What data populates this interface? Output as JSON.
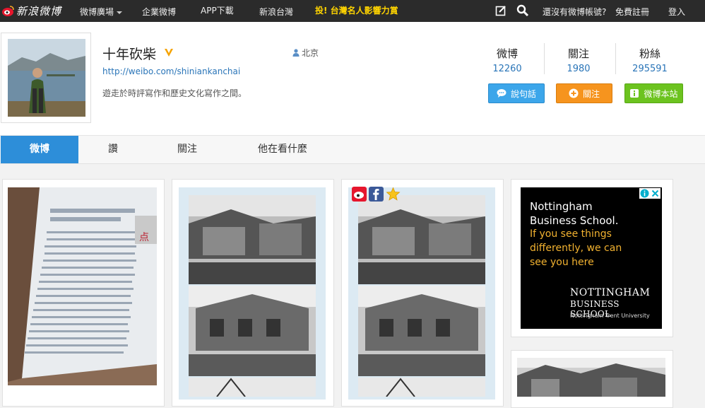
{
  "topbar": {
    "logo_text": "新浪微博",
    "nav": [
      "微博廣場",
      "企業微博",
      "APP下載",
      "新浪台灣"
    ],
    "promo": "投! 台灣名人影響力賞",
    "no_account": "還沒有微博帳號?",
    "register": "免費註冊",
    "login": "登入"
  },
  "profile": {
    "name": "十年砍柴",
    "location": "北京",
    "url": "http://weibo.com/shiniankanchai",
    "bio": "遊走於時評寫作和歷史文化寫作之間。",
    "stats": [
      {
        "label": "微博",
        "value": "12260"
      },
      {
        "label": "關注",
        "value": "1980"
      },
      {
        "label": "粉絲",
        "value": "295591"
      }
    ],
    "buttons": {
      "talk": "說句話",
      "follow": "關注",
      "weibo_site": "微博本站"
    }
  },
  "tabs": [
    "微博",
    "讚",
    "關注",
    "他在看什麼"
  ],
  "ad": {
    "line1": "Nottingham",
    "line2": "Business School.",
    "line3": "If you see things",
    "line4": "differently, we can",
    "line5": "see you here",
    "brand1": "NOTTINGHAM",
    "brand2": "BUSINESS SCHOOL",
    "brand3": "Nottingham Trent University"
  },
  "colors": {
    "topbar_bg": "#2b2b2b",
    "promo": "#ffd400",
    "link": "#2a75b8",
    "tab_active": "#2d8ed9",
    "btn_blue": "#3ca6ea",
    "btn_orange": "#f6941e",
    "btn_green": "#6cc31f",
    "ad_accent": "#f2b230"
  }
}
